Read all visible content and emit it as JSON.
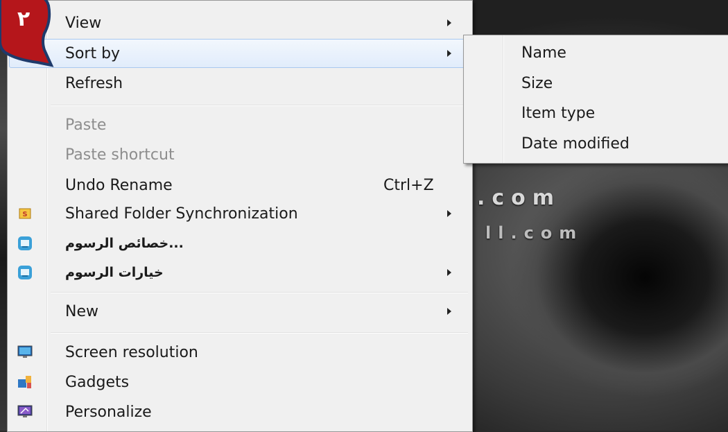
{
  "badge": {
    "number": "٢"
  },
  "wallpaper": {
    "line1": ".com",
    "line2": "ll.com"
  },
  "menu": {
    "items": [
      {
        "label": "View",
        "submenu": true
      },
      {
        "label": "Sort by",
        "submenu": true,
        "highlighted": true
      },
      {
        "label": "Refresh"
      },
      {
        "label": "Paste",
        "disabled": true
      },
      {
        "label": "Paste shortcut",
        "disabled": true
      },
      {
        "label": "Undo Rename",
        "shortcut": "Ctrl+Z"
      },
      {
        "label": "Shared Folder Synchronization",
        "submenu": true,
        "icon": "shared-folder-sync-icon"
      },
      {
        "label": "...خصائص الرسوم",
        "icon": "graphics-properties-icon"
      },
      {
        "label": "خيارات الرسوم",
        "submenu": true,
        "icon": "graphics-options-icon"
      },
      {
        "label": "New",
        "submenu": true
      },
      {
        "label": "Screen resolution",
        "icon": "screen-resolution-icon"
      },
      {
        "label": "Gadgets",
        "icon": "gadgets-icon"
      },
      {
        "label": "Personalize",
        "icon": "personalize-icon"
      }
    ]
  },
  "submenu": {
    "items": [
      {
        "label": "Name"
      },
      {
        "label": "Size"
      },
      {
        "label": "Item type"
      },
      {
        "label": "Date modified"
      }
    ]
  },
  "colors": {
    "menu_bg": "#f0f0f0",
    "highlight_border": "#a8c8ef",
    "badge_red": "#b5161b",
    "badge_border": "#1f3a6b"
  }
}
